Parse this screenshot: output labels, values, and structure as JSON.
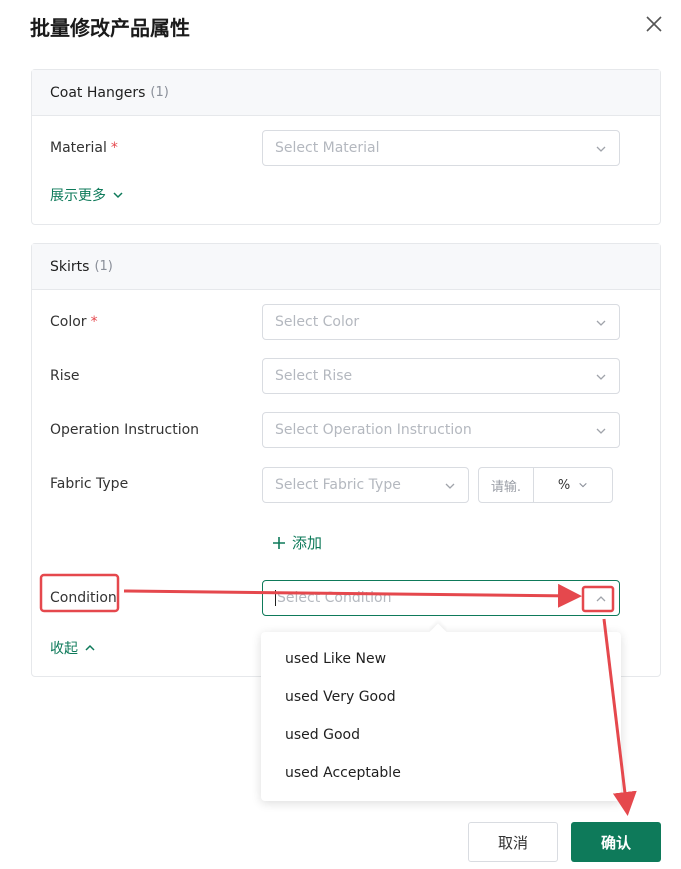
{
  "modal": {
    "title": "批量修改产品属性"
  },
  "section1": {
    "name": "Coat Hangers",
    "count": "(1)",
    "fields": {
      "material_label": "Material",
      "material_required": "*",
      "material_placeholder": "Select Material"
    },
    "show_more": "展示更多"
  },
  "section2": {
    "name": "Skirts",
    "count": "(1)",
    "fields": {
      "color_label": "Color",
      "color_required": "*",
      "color_placeholder": "Select Color",
      "rise_label": "Rise",
      "rise_placeholder": "Select Rise",
      "operation_label": "Operation Instruction",
      "operation_placeholder": "Select Operation Instruction",
      "fabric_label": "Fabric Type",
      "fabric_placeholder": "Select Fabric Type",
      "fabric_input_placeholder": "请输.",
      "fabric_unit": "%",
      "add_label": "添加",
      "condition_label": "Condition",
      "condition_placeholder": "Select Condition"
    },
    "collapse": "收起"
  },
  "dropdown": {
    "options": [
      "used Like New",
      "used Very Good",
      "used Good",
      "used Acceptable"
    ]
  },
  "footer": {
    "cancel": "取消",
    "confirm": "确认"
  },
  "colors": {
    "accent": "#0e7a5a",
    "required": "#e5484d",
    "annotation": "#e5484d"
  }
}
